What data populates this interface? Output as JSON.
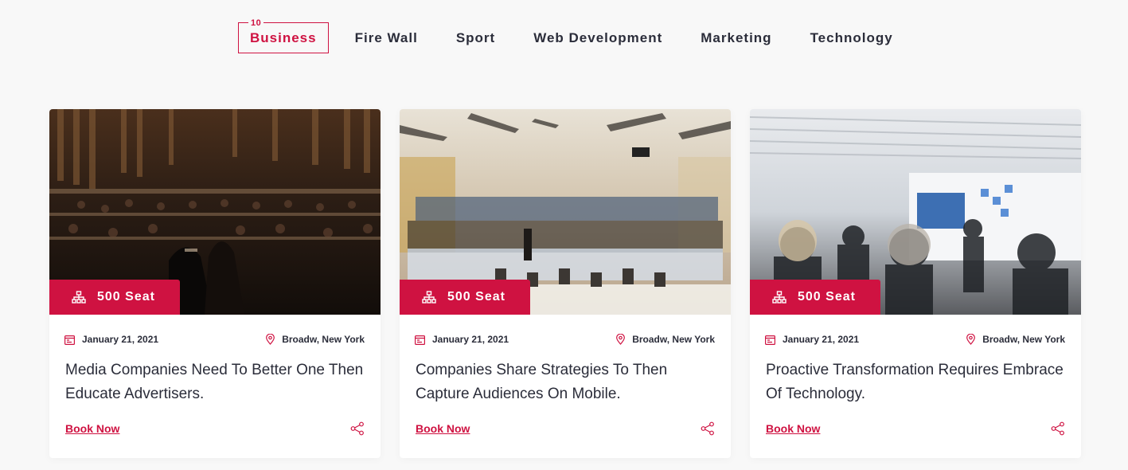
{
  "tabs": {
    "active_count": "10",
    "items": [
      {
        "label": "Business"
      },
      {
        "label": "Fire Wall"
      },
      {
        "label": "Sport"
      },
      {
        "label": "Web Development"
      },
      {
        "label": "Marketing"
      },
      {
        "label": "Technology"
      }
    ]
  },
  "colors": {
    "accent": "#cf1241",
    "text": "#2b2d3a",
    "background": "#f8f8f8"
  },
  "cards": [
    {
      "seat": "500 Seat",
      "date": "January 21, 2021",
      "location": "Broadw, New York",
      "title": "Media Companies Need To Better One Then Educate Advertisers.",
      "cta": "Book Now",
      "photo_icon": "auditorium-photo"
    },
    {
      "seat": "500 Seat",
      "date": "January 21, 2021",
      "location": "Broadw, New York",
      "title": "Companies Share Strategies To Then Capture Audiences On Mobile.",
      "cta": "Book Now",
      "photo_icon": "lecture-hall-photo"
    },
    {
      "seat": "500 Seat",
      "date": "January 21, 2021",
      "location": "Broadw, New York",
      "title": "Proactive Transformation Requires Embrace Of Technology.",
      "cta": "Book Now",
      "photo_icon": "exhibition-photo"
    }
  ]
}
